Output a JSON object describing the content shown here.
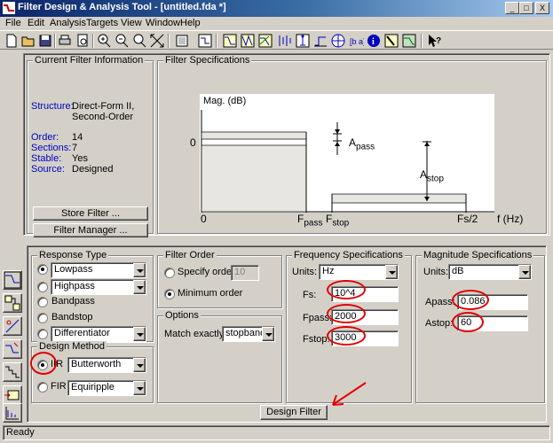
{
  "window": {
    "title": "Filter Design & Analysis Tool - [untitled.fda *]"
  },
  "window_controls": {
    "minimize": "_",
    "maximize": "□",
    "close": "X"
  },
  "menu": [
    "File",
    "Edit",
    "Analysis",
    "Targets",
    "View",
    "Window",
    "Help"
  ],
  "toolbar_icons": [
    "new-icon",
    "open-icon",
    "save-icon",
    "print-icon",
    "print-preview-icon",
    "zoom-in-icon",
    "zoom-out-icon",
    "zoom-x-icon",
    "zoom-fit-icon",
    "fullview-icon",
    "filter-specs-icon",
    "magnitude-response-icon",
    "phase-response-icon",
    "mag-phase-icon",
    "group-delay-icon",
    "impulse-response-icon",
    "step-response-icon",
    "pole-zero-icon",
    "coefficients-icon",
    "info-icon",
    "round-off-icon",
    "compare-icon",
    "whats-this-icon"
  ],
  "current_filter": {
    "group_label": "Current Filter Information",
    "structure_label": "Structure:",
    "structure_value": "Direct-Form II, Second-Order Sections",
    "order_label": "Order:",
    "order_value": "14",
    "sections_label": "Sections:",
    "sections_value": "7",
    "stable_label": "Stable:",
    "stable_value": "Yes",
    "source_label": "Source:",
    "source_value": "Designed",
    "store_button": "Store Filter ...",
    "manager_button": "Filter Manager ..."
  },
  "filter_specs": {
    "group_label": "Filter Specifications",
    "ylabel": "Mag. (dB)",
    "y0": "0",
    "x0": "0",
    "fpass": "F",
    "fpass_sub": "pass",
    "fstop": "F",
    "fstop_sub": "stop",
    "fs2": "Fs/2",
    "xunit": "f (Hz)",
    "apass": "A",
    "apass_sub": "pass",
    "astop": "A",
    "astop_sub": "stop"
  },
  "response_type": {
    "group_label": "Response Type",
    "options": [
      {
        "label": "Lowpass",
        "dropdown": true,
        "selected": true
      },
      {
        "label": "Highpass",
        "dropdown": true,
        "selected": false
      },
      {
        "label": "Bandpass",
        "dropdown": false,
        "selected": false
      },
      {
        "label": "Bandstop",
        "dropdown": false,
        "selected": false
      },
      {
        "label": "Differentiator",
        "dropdown": true,
        "selected": false
      }
    ]
  },
  "design_method": {
    "group_label": "Design Method",
    "iir_label": "IIR",
    "iir_value": "Butterworth",
    "fir_label": "FIR",
    "fir_value": "Equiripple"
  },
  "filter_order": {
    "group_label": "Filter Order",
    "specify_label": "Specify order:",
    "specify_value": "10",
    "minimum_label": "Minimum order"
  },
  "options": {
    "group_label": "Options",
    "match_label": "Match exactly:",
    "match_value": "stopband"
  },
  "freq_specs": {
    "group_label": "Frequency Specifications",
    "units_label": "Units:",
    "units_value": "Hz",
    "fs_label": "Fs:",
    "fs_value": "10^4",
    "fpass_label": "Fpass:",
    "fpass_value": "2000",
    "fstop_label": "Fstop:",
    "fstop_value": "3000"
  },
  "mag_specs": {
    "group_label": "Magnitude Specifications",
    "units_label": "Units:",
    "units_value": "dB",
    "apass_label": "Apass:",
    "apass_value": "0.086",
    "astop_label": "Astop:",
    "astop_value": "60"
  },
  "design_button": "Design Filter",
  "status": "Ready",
  "colors": {
    "annotation": "#e00000",
    "label_blue": "#0000c0",
    "face": "#d4d0c8"
  }
}
